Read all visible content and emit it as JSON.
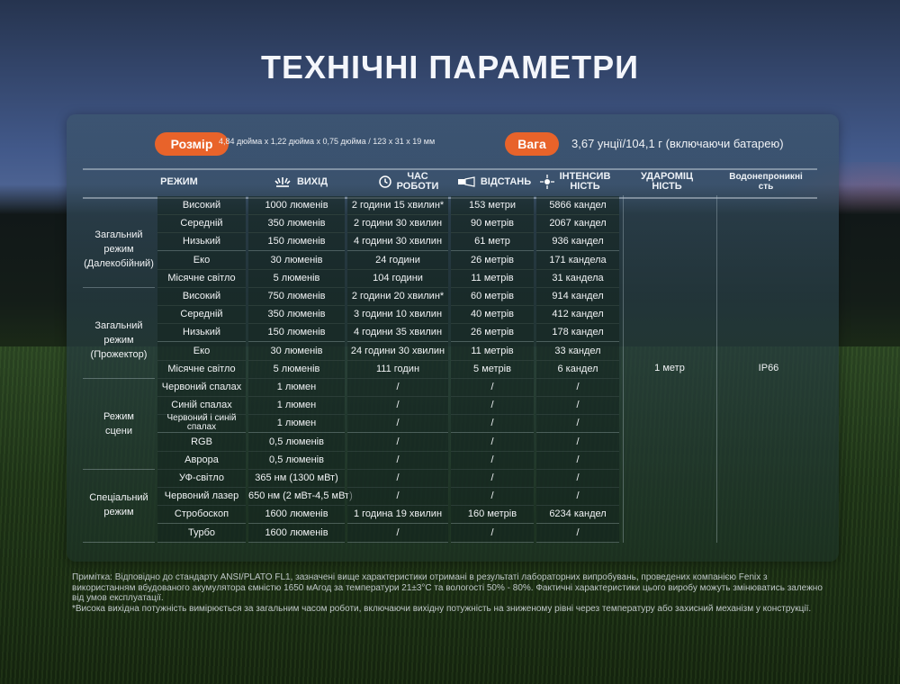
{
  "title": "ТЕХНІЧНІ ПАРАМЕТРИ",
  "size": {
    "label": "Розмір",
    "value": "4,84 дюйма x 1,22 дюйма x 0,75 дюйма / 123 x 31 x 19 мм"
  },
  "weight": {
    "label": "Вага",
    "value": "3,67 унції/104,1 г (включаючи батарею)"
  },
  "headers": {
    "mode": "РЕЖИМ",
    "output": "ВИХІД",
    "runtime": "ЧАС\nРОБОТИ",
    "distance": "ВІДСТАНЬ",
    "intensity": "ІНТЕНСИВ\nНІСТЬ",
    "impact": "УДАРОМІЦ\nНІСТЬ",
    "waterproof": "Водонепроникні\nсть"
  },
  "groups": [
    {
      "name": "Загальний режим\n(Далекобійний)"
    },
    {
      "name": "Загальний режим\n(Прожектор)"
    },
    {
      "name": "Режим\nсцени"
    },
    {
      "name": "Спеціальний\nрежим"
    }
  ],
  "rows": [
    [
      "Високий",
      "1000 люменів",
      "2 години 15 хвилин*",
      "153 метри",
      "5866 кандел"
    ],
    [
      "Середній",
      "350 люменів",
      "2 години 30 хвилин",
      "90 метрів",
      "2067 кандел"
    ],
    [
      "Низький",
      "150 люменів",
      "4 години 30 хвилин",
      "61 метр",
      "936 кандел"
    ],
    [
      "Еко",
      "30 люменів",
      "24 години",
      "26 метрів",
      "171 кандела"
    ],
    [
      "Місячне світло",
      "5 люменів",
      "104 години",
      "11 метрів",
      "31 кандела"
    ],
    [
      "Високий",
      "750 люменів",
      "2 години 20 хвилин*",
      "60 метрів",
      "914 кандел"
    ],
    [
      "Середній",
      "350 люменів",
      "3 години 10 хвилин",
      "40 метрів",
      "412 кандел"
    ],
    [
      "Низький",
      "150 люменів",
      "4 години 35 хвилин",
      "26 метрів",
      "178 кандел"
    ],
    [
      "Еко",
      "30 люменів",
      "24 години 30 хвилин",
      "11 метрів",
      "33 кандел"
    ],
    [
      "Місячне світло",
      "5 люменів",
      "111 годин",
      "5 метрів",
      "6 кандел"
    ],
    [
      "Червоний спалах",
      "1 люмен",
      "/",
      "/",
      "/"
    ],
    [
      "Синій спалах",
      "1 люмен",
      "/",
      "/",
      "/"
    ],
    [
      "Червоний і синій спалах",
      "1 люмен",
      "/",
      "/",
      "/"
    ],
    [
      "RGB",
      "0,5 люменів",
      "/",
      "/",
      "/"
    ],
    [
      "Аврора",
      "0,5 люменів",
      "/",
      "/",
      "/"
    ],
    [
      "УФ-світло",
      "365 нм (1300 мВт)",
      "/",
      "/",
      "/"
    ],
    [
      "Червоний лазер",
      "650 нм (2 мВт-4,5 мВт)",
      "/",
      "/",
      "/"
    ],
    [
      "Стробоскоп",
      "1600 люменів",
      "1 година 19 хвилин",
      "160 метрів",
      "6234 кандел"
    ],
    [
      "Турбо",
      "1600 люменів",
      "/",
      "/",
      "/"
    ]
  ],
  "impact_value": "1 метр",
  "waterproof_value": "IP66",
  "notes": [
    "Примітка: Відповідно до стандарту ANSI/PLATO FL1, зазначені вище характеристики отримані в результаті лабораторних випробувань, проведених компанією Fenix з використанням вбудованого акумулятора ємністю 1650 мАгод за температури 21±3°C та вологості 50% - 80%. Фактичні характеристики цього виробу можуть змінюватись залежно від умов експлуатації.",
    "*Висока вихідна потужність вимірюється за загальним часом роботи, включаючи вихідну потужність на зниженому рівні через температуру або захисний механізм у конструкції."
  ]
}
